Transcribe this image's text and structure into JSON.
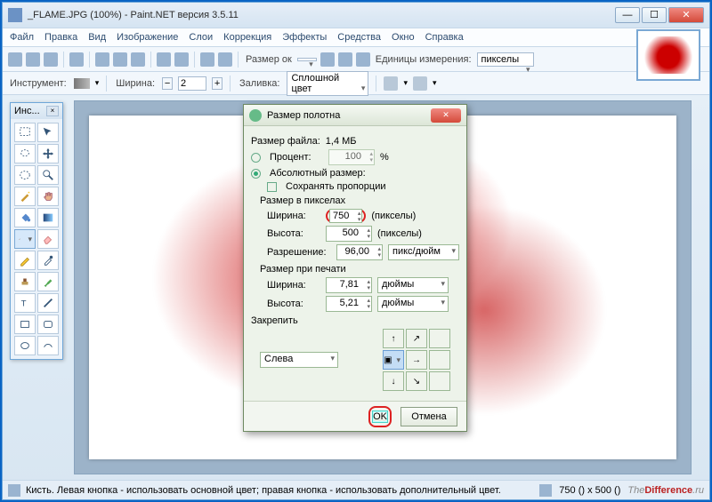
{
  "window": {
    "title": "_FLAME.JPG (100%) - Paint.NET версия 3.5.11"
  },
  "menu": {
    "file": "Файл",
    "edit": "Правка",
    "view": "Вид",
    "image": "Изображение",
    "layers": "Слои",
    "adjust": "Коррекция",
    "effects": "Эффекты",
    "tools": "Средства",
    "window": "Окно",
    "help": "Справка"
  },
  "toolbar": {
    "size_label": "Размер ок",
    "units_label": "Единицы измерения:",
    "units_value": "пикселы"
  },
  "toolbar2": {
    "instrument": "Инструмент:",
    "width_label": "Ширина:",
    "width_value": "2",
    "fill_label": "Заливка:",
    "fill_value": "Сплошной цвет"
  },
  "toolswin": {
    "title": "Инс..."
  },
  "dialog": {
    "title": "Размер полотна",
    "filesize_label": "Размер файла:",
    "filesize_value": "1,4 МБ",
    "percent_label": "Процент:",
    "percent_value": "100",
    "percent_unit": "%",
    "abs_label": "Абсолютный размер:",
    "keep_ratio": "Сохранять пропорции",
    "px_group": "Размер в пикселах",
    "w_label": "Ширина:",
    "w_value": "750",
    "w_unit": "(пикселы)",
    "h_label": "Высота:",
    "h_value": "500",
    "h_unit": "(пикселы)",
    "res_label": "Разрешение:",
    "res_value": "96,00",
    "res_unit": "пикс/дюйм",
    "print_group": "Размер при печати",
    "pw_label": "Ширина:",
    "pw_value": "7,81",
    "pw_unit": "дюймы",
    "ph_label": "Высота:",
    "ph_value": "5,21",
    "ph_unit": "дюймы",
    "anchor_label": "Закрепить",
    "anchor_value": "Слева",
    "ok": "OK",
    "cancel": "Отмена"
  },
  "status": {
    "text": "Кисть. Левая кнопка - использовать основной цвет; правая кнопка - использовать дополнительный цвет.",
    "dims": "750 () x 500 ()",
    "brand1": "The",
    "brand2": "Difference",
    "brand3": ".ru"
  }
}
